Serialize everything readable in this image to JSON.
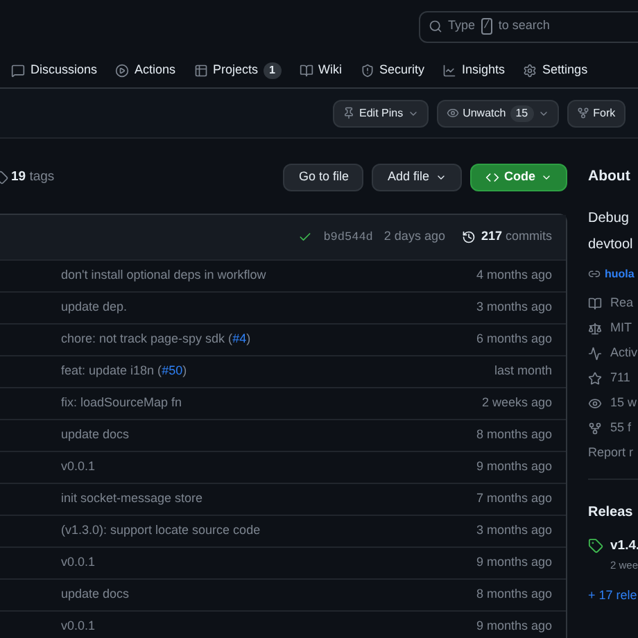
{
  "search": {
    "prefix": "Type",
    "key": "/",
    "suffix": "to search"
  },
  "tabs": [
    {
      "label": "Discussions"
    },
    {
      "label": "Actions"
    },
    {
      "label": "Projects",
      "counter": "1"
    },
    {
      "label": "Wiki"
    },
    {
      "label": "Security"
    },
    {
      "label": "Insights"
    },
    {
      "label": "Settings"
    }
  ],
  "repo_actions": [
    {
      "kind": "dropdown",
      "label": "Edit Pins"
    },
    {
      "kind": "dropdown",
      "label": "Unwatch",
      "counter": "15"
    },
    {
      "kind": "plain",
      "label": "Fork"
    }
  ],
  "tags": {
    "count": "19",
    "label": "tags"
  },
  "file_buttons": [
    {
      "kind": "plain",
      "label": "Go to file"
    },
    {
      "kind": "dropdown",
      "label": "Add file"
    },
    {
      "kind": "primary",
      "label": "Code"
    }
  ],
  "latest_commit": {
    "hash": "b9d544d",
    "time": "2 days ago",
    "commits": "**217** commits"
  },
  "rows": [
    {
      "message": "don't install optional deps in workflow",
      "time": "4 months ago"
    },
    {
      "message": "update dep.",
      "time": "3 months ago"
    },
    {
      "message": "chore: not track page-spy sdk (",
      "link": "#4",
      "after": ")",
      "time": "6 months ago"
    },
    {
      "message": "feat: update i18n (",
      "link": "#50",
      "after": ")",
      "time": "last month"
    },
    {
      "message": "fix: loadSourceMap fn",
      "time": "2 weeks ago"
    },
    {
      "message": "update docs",
      "time": "8 months ago"
    },
    {
      "message": "v0.0.1",
      "time": "9 months ago"
    },
    {
      "message": "init socket-message store",
      "time": "7 months ago"
    },
    {
      "message": "(v1.3.0): support locate source code",
      "time": "3 months ago"
    },
    {
      "message": "v0.0.1",
      "time": "9 months ago"
    },
    {
      "message": "update docs",
      "time": "8 months ago"
    },
    {
      "message": "v0.0.1",
      "time": "9 months ago"
    }
  ],
  "about": {
    "title": "About",
    "description": [
      "Debug",
      "devtool"
    ],
    "link": "huola",
    "items": [
      "Rea",
      "MIT",
      "Activ",
      "711",
      "15 w",
      "55 f"
    ],
    "report": "Report r"
  },
  "releases": {
    "title": "Releas",
    "latest": "v1.4.",
    "date": "2 wee",
    "more": "+ 17 rele"
  }
}
